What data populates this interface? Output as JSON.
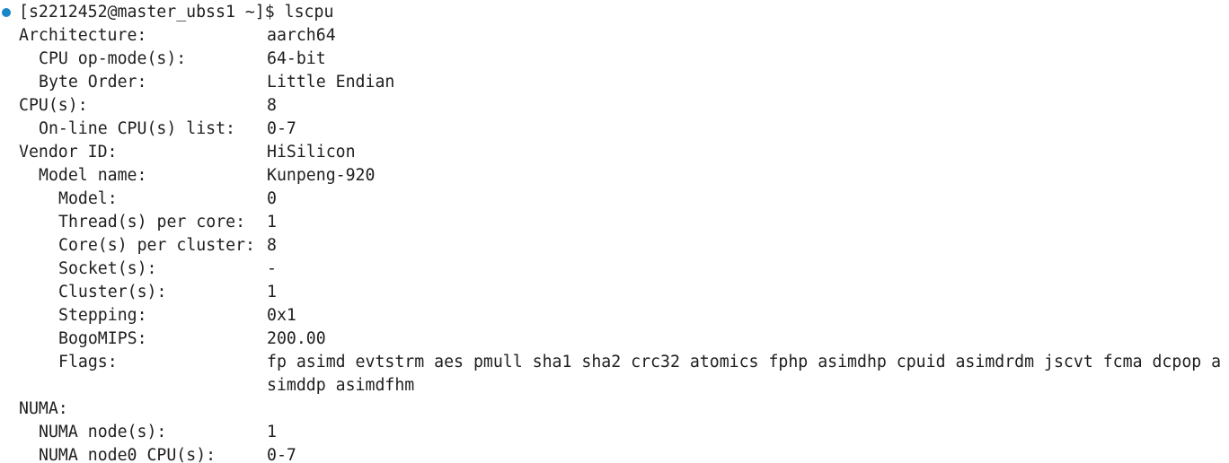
{
  "terminal": {
    "colors": {
      "background": "#ffffff",
      "text": "#1f1f1f",
      "status_dot": "#1a85c8"
    },
    "status_icon": "command-success-dot",
    "prompt": "[s2212452@master_ubss1 ~]$ lscpu",
    "rows": [
      {
        "key": "Architecture:",
        "value": "aarch64"
      },
      {
        "key": "CPU op-mode(s):",
        "value": "64-bit"
      },
      {
        "key": "Byte Order:",
        "value": "Little Endian"
      },
      {
        "key": "CPU(s):",
        "value": "8"
      },
      {
        "key": "On-line CPU(s) list:",
        "value": "0-7"
      },
      {
        "key": "Vendor ID:",
        "value": "HiSilicon"
      },
      {
        "key": "Model name:",
        "value": "Kunpeng-920"
      },
      {
        "key": "Model:",
        "value": "0"
      },
      {
        "key": "Thread(s) per core:",
        "value": "1"
      },
      {
        "key": "Core(s) per cluster:",
        "value": "8"
      },
      {
        "key": "Socket(s):",
        "value": "-"
      },
      {
        "key": "Cluster(s):",
        "value": "1"
      },
      {
        "key": "Stepping:",
        "value": "0x1"
      },
      {
        "key": "BogoMIPS:",
        "value": "200.00"
      },
      {
        "key": "Flags:",
        "value": "fp asimd evtstrm aes pmull sha1 sha2 crc32 atomics fphp asimdhp cpuid asimdrdm jscvt fcma dcpop a"
      },
      {
        "key": "",
        "value": "simddp asimdfhm"
      },
      {
        "key": "NUMA:",
        "value": ""
      },
      {
        "key": "NUMA node(s):",
        "value": "1"
      },
      {
        "key": "NUMA node0 CPU(s):",
        "value": "0-7"
      }
    ]
  }
}
